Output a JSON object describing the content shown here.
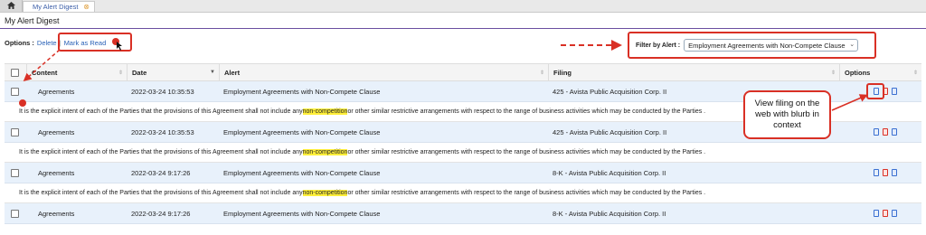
{
  "tabs": {
    "home_icon": "home-icon",
    "active_tab": "My Alert Digest"
  },
  "page_title": "My Alert Digest",
  "options": {
    "label": "Options :",
    "delete": "Delete",
    "separator": "|",
    "mark_read": "Mark as Read"
  },
  "filter": {
    "label": "Filter by Alert :",
    "selected": "Employment Agreements with Non-Compete Clause"
  },
  "table": {
    "headers": {
      "content": "Content",
      "date": "Date",
      "alert": "Alert",
      "filing": "Filing",
      "options": "Options"
    },
    "rows": [
      {
        "content": "Agreements",
        "date": "2022-03-24 10:35:53",
        "alert": "Employment Agreements with Non-Compete Clause",
        "filing": "425 - Avista Public Acquisition Corp. II",
        "blurb_pre": "It is the explicit intent of each of the Parties that the provisions of this Agreement shall not include any ",
        "blurb_hl": "non-competition",
        "blurb_post": " or other similar restrictive arrangements with respect to the range of business activities which may be conducted by the Parties ."
      },
      {
        "content": "Agreements",
        "date": "2022-03-24 10:35:53",
        "alert": "Employment Agreements with Non-Compete Clause",
        "filing": "425 - Avista Public Acquisition Corp. II",
        "blurb_pre": "It is the explicit intent of each of the Parties that the provisions of this Agreement shall not include any ",
        "blurb_hl": "non-competition",
        "blurb_post": " or other similar restrictive arrangements with respect to the range of business activities which may be conducted by the Parties ."
      },
      {
        "content": "Agreements",
        "date": "2022-03-24 9:17:26",
        "alert": "Employment Agreements with Non-Compete Clause",
        "filing": "8-K - Avista Public Acquisition Corp. II",
        "blurb_pre": "It is the explicit intent of each of the Parties that the provisions of this Agreement shall not include any ",
        "blurb_hl": "non-competition",
        "blurb_post": " or other similar restrictive arrangements with respect to the range of business activities which may be conducted by the Parties ."
      },
      {
        "content": "Agreements",
        "date": "2022-03-24 9:17:26",
        "alert": "Employment Agreements with Non-Compete Clause",
        "filing": "8-K - Avista Public Acquisition Corp. II"
      }
    ]
  },
  "annotation": "View filing on the web with blurb in context",
  "colors": {
    "accent_red": "#d93025",
    "row_blue": "#e8f1fb",
    "highlight": "#ffef3a",
    "link": "#2a62b7"
  }
}
